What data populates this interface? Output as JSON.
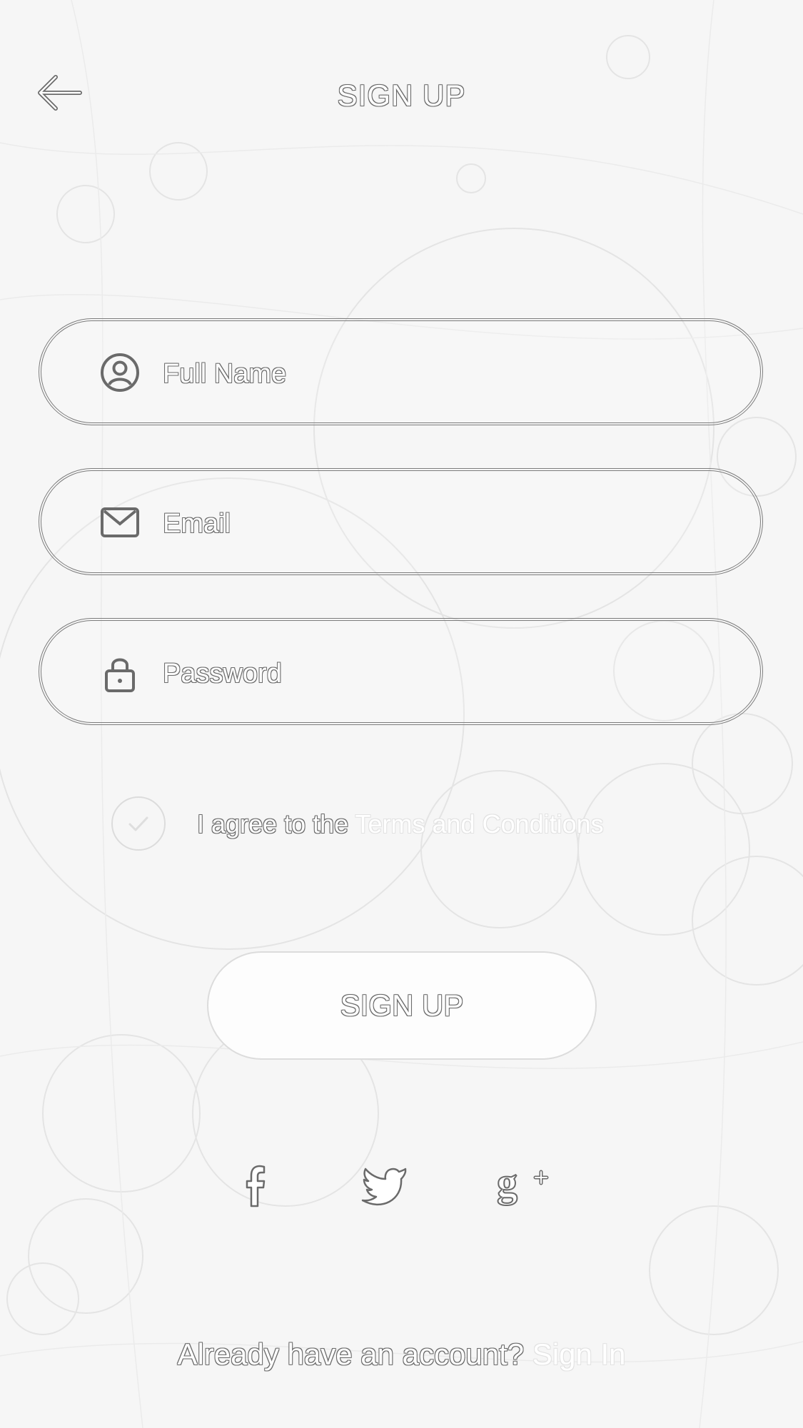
{
  "header": {
    "title": "SIGN UP",
    "back_icon": "arrow-left-icon"
  },
  "form": {
    "full_name": {
      "placeholder": "Full Name",
      "value": "",
      "icon": "user-icon"
    },
    "email": {
      "placeholder": "Email",
      "value": "",
      "icon": "envelope-icon"
    },
    "password": {
      "placeholder": "Password",
      "value": "",
      "icon": "lock-icon"
    }
  },
  "agreement": {
    "checked": false,
    "prefix": "I agree to the ",
    "link_label": "Terms and Conditions"
  },
  "submit": {
    "label": "SIGN UP"
  },
  "social": {
    "icons": [
      "facebook-icon",
      "twitter-icon",
      "google-plus-icon"
    ]
  },
  "footer": {
    "prompt": "Already have an account? ",
    "link_label": "Sign In"
  },
  "colors": {
    "background": "#f7f7f7",
    "outline": "#6a6a6a",
    "text": "#ffffff"
  }
}
